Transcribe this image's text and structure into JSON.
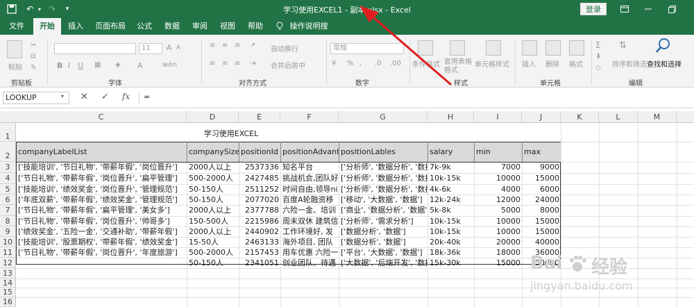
{
  "window": {
    "title": "学习使用EXCEL1 - 副本.xlsx  -  Excel",
    "login": "登录",
    "qa_undo": "↶",
    "qa_redo": "↷"
  },
  "tabs": [
    "文件",
    "开始",
    "插入",
    "页面布局",
    "公式",
    "数据",
    "审阅",
    "视图",
    "帮助",
    "操作说明搜索"
  ],
  "ribbon": {
    "paste": "粘贴",
    "font_size": "11",
    "wrap": "自动换行",
    "merge": "合并后居中",
    "number_format": "常规",
    "cond_format": "条件格式",
    "table_format": "套用表格格式",
    "cell_style": "单元格样式",
    "insert": "插入",
    "delete": "删除",
    "format": "格式",
    "sort": "排序和筛选",
    "find": "查找和选择",
    "groups": [
      "剪贴板",
      "字体",
      "对齐方式",
      "数字",
      "样式",
      "单元格",
      "编辑"
    ]
  },
  "formula_bar": {
    "name_box": "LOOKUP",
    "formula": "="
  },
  "columns": [
    "C",
    "D",
    "E",
    "F",
    "G",
    "H",
    "I",
    "J",
    "K",
    "L",
    "M"
  ],
  "rows": [
    "1",
    "2",
    "3",
    "4",
    "5",
    "6",
    "7",
    "8",
    "9",
    "10",
    "11",
    "12",
    "13",
    "14",
    "15",
    "16",
    "17"
  ],
  "sheet": {
    "title": "学习使用EXCEL",
    "headers": [
      "companyLabelList",
      "companySize",
      "positionId",
      "positionAdvanta",
      "positionLables",
      "salary",
      "min",
      "max"
    ],
    "data": [
      [
        "['技能培训', '节日礼物', '带薪年假', '岗位晋升']",
        "2000人以上",
        "2537336",
        "知名平台",
        "['分析师', '数据分析', '数据",
        "7k-9k",
        "7000",
        "9000"
      ],
      [
        "['节日礼物', '带薪年假', '岗位晋升', '扁平管理']",
        "500-2000人",
        "2427485",
        "挑战机会,团队好",
        "['分析师', '数据分析', '数据",
        "10k-15k",
        "10000",
        "15000"
      ],
      [
        "['技能培训', '绩效奖金', '岗位晋升', '管理规范']",
        "50-150人",
        "2511252",
        "时间自由,领导ni",
        "['分析师', '数据分析', '数据",
        "4k-6k",
        "4000",
        "6000"
      ],
      [
        "['年底双薪', '带薪年假', '绩效奖金', '管理规范']",
        "50-150人",
        "2077020",
        "百度A轮融资移",
        "['移动', '大数据', '数据']",
        "12k-24k",
        "12000",
        "24000"
      ],
      [
        "['节日礼物', '带薪年假', '扁平管理', '美女多']",
        "2000人以上",
        "2377788",
        "六险一金、培训",
        "['商业', '数据分析', '数据']",
        "5k-8k",
        "5000",
        "8000"
      ],
      [
        "['节日礼物', '带薪年假', '岗位晋升', '帅哥多']",
        "150-500人",
        "2215986",
        "周末双休 建筑信",
        "['分析师', '需求分析']",
        "10k-15k",
        "10000",
        "15000"
      ],
      [
        "['绩效奖金', '五险一金', '交通补助', '带薪年假']",
        "2000人以上",
        "2440902",
        "工作环境好, 发",
        "['数据分析', '数据']",
        "10k-15k",
        "10000",
        "15000"
      ],
      [
        "['技能培训', '股票期权', '带薪年假', '绩效奖金']",
        "15-50人",
        "2463133",
        "海外项目, 团队",
        "['数据分析', '数据']",
        "20k-40k",
        "20000",
        "40000"
      ],
      [
        "['节日礼物', '带薪年假', '岗位晋升', '年度旅游']",
        "500-2000人",
        "2157453",
        "用车优惠 六险一",
        "['平台', '大数据', '数据']",
        "18k-36k",
        "18000",
        "36000"
      ],
      [
        "",
        "50-150人",
        "2341051",
        "创业团队、待遇",
        "['大数据', '后端开发', '数据",
        "15k-30k",
        "15000",
        "30000"
      ]
    ]
  },
  "watermark": {
    "brand": "Bai",
    "cn": "经验",
    "url": "jingyan.baidu.com"
  },
  "colors": {
    "excel_green": "#217346",
    "arrow_red": "#e02020"
  }
}
